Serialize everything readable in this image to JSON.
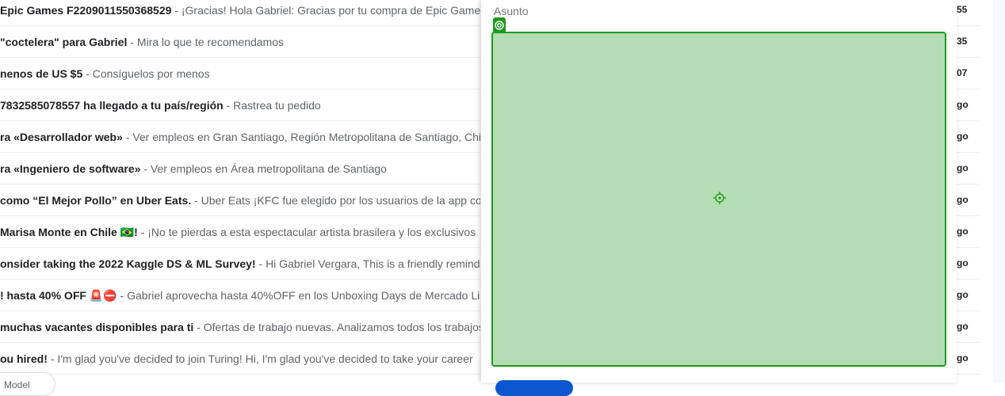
{
  "inbox": {
    "rows": [
      {
        "subject": "Epic Games F2209011550368529",
        "snippet": "¡Gracias! Hola Gabriel: Gracias por tu compra de Epic Games",
        "time": "55"
      },
      {
        "subject": "\"coctelera\" para Gabriel",
        "snippet": "Mira lo que te recomendamos",
        "time": "35"
      },
      {
        "subject": "nenos de US $5",
        "snippet": "Consíguelos por menos",
        "time": "07"
      },
      {
        "subject": "7832585078557 ha llegado a tu país/región",
        "snippet": "Rastrea tu pedido",
        "time": "go"
      },
      {
        "subject": "ra «Desarrollador web»",
        "snippet": "Ver empleos en Gran Santiago, Región Metropolitana de Santiago, Chile",
        "time": "go"
      },
      {
        "subject": "ra «Ingeniero de software»",
        "snippet": "Ver empleos en Área metropolitana de Santiago",
        "time": "go"
      },
      {
        "subject": "como “El Mejor Pollo” en Uber Eats.",
        "snippet": "Uber Eats ¡KFC fue elegido por los usuarios de la app como",
        "time": "go"
      },
      {
        "subject": "Marisa Monte en Chile 🇧🇷!",
        "snippet": "¡No te pierdas a esta espectacular artista brasilera y los exclusivos",
        "time": "go"
      },
      {
        "subject": "onsider taking the 2022 Kaggle DS & ML Survey!",
        "snippet": "Hi Gabriel Vergara, This is a friendly reminder",
        "time": "go"
      },
      {
        "subject": "! hasta 40% OFF 🚨⛔",
        "snippet": "Gabriel aprovecha hasta 40%OFF en los Unboxing Days de Mercado Libre",
        "time": "go"
      },
      {
        "subject": "muchas vacantes disponibles para ti",
        "snippet": "Ofertas de trabajo nuevas. Analizamos todos los trabajos",
        "time": "go"
      },
      {
        "subject": "ou hired!",
        "snippet": "I'm glad you've decided to join Turing! Hi, I'm glad you've decided to take your career",
        "time": "go"
      }
    ],
    "chip_label": "Model"
  },
  "compose": {
    "subject_placeholder": "Asunto",
    "body_value": ""
  },
  "colors": {
    "highlight_fill": "#b4ddb4",
    "highlight_border": "#1e9a1e",
    "send_button": "#0b57d0"
  },
  "icons": {
    "handle": "target-icon",
    "center": "crosshair-icon"
  }
}
